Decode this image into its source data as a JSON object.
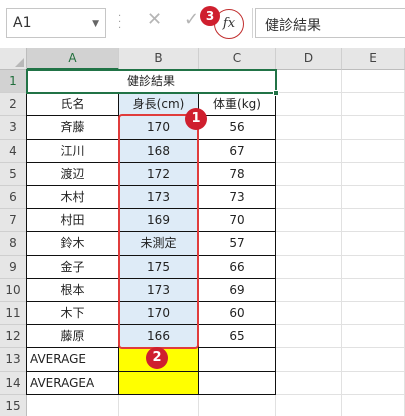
{
  "formula_bar": {
    "name_box": "A1",
    "cancel_icon": "✕",
    "enter_icon": "✓",
    "fx_label": "fx",
    "content": "健診結果"
  },
  "columns": [
    "A",
    "B",
    "C",
    "D",
    "E"
  ],
  "rows": [
    "1",
    "2",
    "3",
    "4",
    "5",
    "6",
    "7",
    "8",
    "9",
    "10",
    "11",
    "12",
    "13",
    "14",
    "15"
  ],
  "sheet": {
    "title": "健診結果",
    "headers": {
      "name": "氏名",
      "height": "身長(cm)",
      "weight": "体重(kg)"
    },
    "records": [
      {
        "name": "斉藤",
        "height": "170",
        "weight": "56"
      },
      {
        "name": "江川",
        "height": "168",
        "weight": "67"
      },
      {
        "name": "渡辺",
        "height": "172",
        "weight": "78"
      },
      {
        "name": "木村",
        "height": "173",
        "weight": "73"
      },
      {
        "name": "村田",
        "height": "169",
        "weight": "70"
      },
      {
        "name": "鈴木",
        "height": "未測定",
        "weight": "57"
      },
      {
        "name": "金子",
        "height": "175",
        "weight": "66"
      },
      {
        "name": "根本",
        "height": "173",
        "weight": "69"
      },
      {
        "name": "木下",
        "height": "170",
        "weight": "60"
      },
      {
        "name": "藤原",
        "height": "166",
        "weight": "65"
      }
    ],
    "average_label": "AVERAGE",
    "averagea_label": "AVERAGEA"
  },
  "badges": {
    "one": "1",
    "two": "2",
    "three": "3"
  },
  "colors": {
    "selection_green": "#217346",
    "highlight_red": "#e03c3c",
    "badge_red": "#cf1f2e",
    "blue_fill": "#deebf7",
    "yellow_fill": "#ffff00"
  }
}
